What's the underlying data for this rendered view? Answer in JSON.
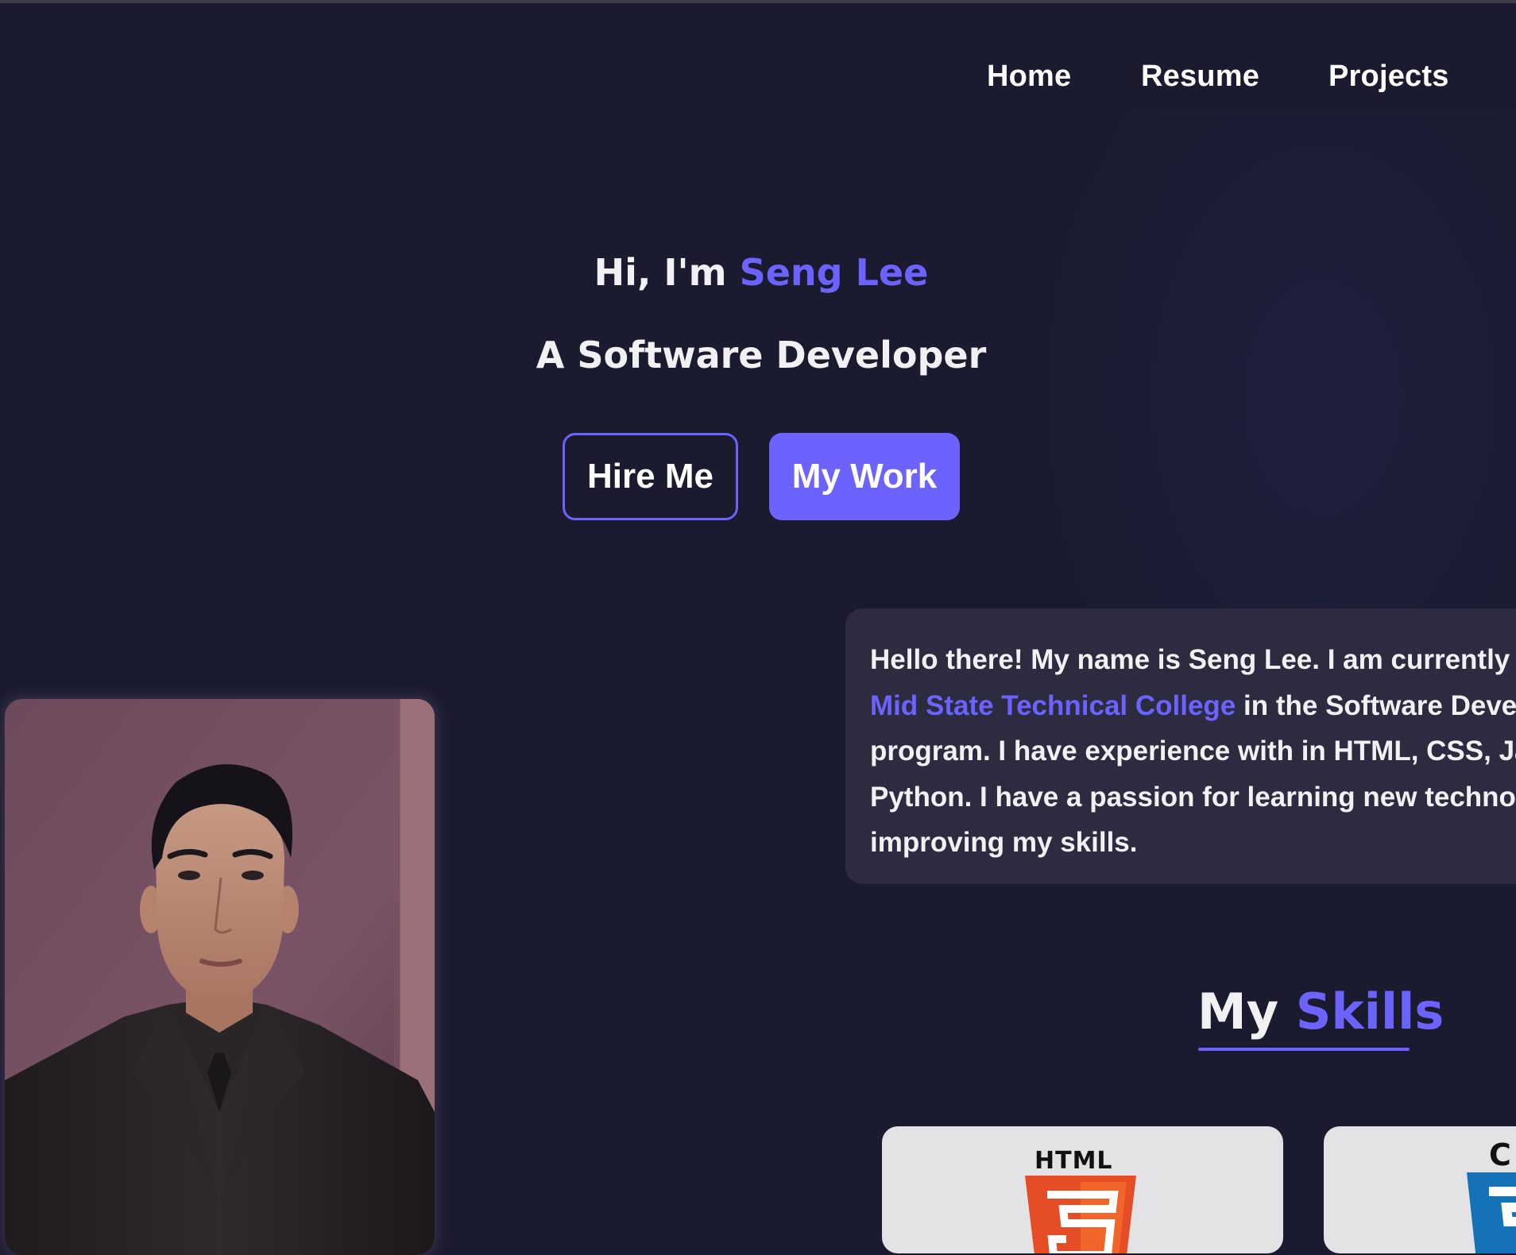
{
  "nav": {
    "home": "Home",
    "resume": "Resume",
    "projects": "Projects"
  },
  "hero": {
    "greeting_prefix": "Hi, I'm",
    "name": "Seng Lee",
    "role": "A Software Developer",
    "hire_button": "Hire Me",
    "work_button": "My Work"
  },
  "about": {
    "line1": "Hello there! My name is Seng Lee. I am currently",
    "college_link": "Mid State Technical College",
    "line2_rest": "in the Software Deve",
    "line3": "program. I have experience with in HTML, CSS, Ja",
    "line4": "Python. I have a passion for learning new techno",
    "line5": "improving my skills."
  },
  "skills": {
    "title_prefix": "My",
    "title_accent": "Skills",
    "items": [
      {
        "label": "HTML",
        "icon": "html5-icon"
      },
      {
        "label": "C",
        "icon": "css3-icon"
      }
    ]
  },
  "colors": {
    "background": "#1b1b30",
    "accent": "#6c63ff",
    "card": "#2c2b40",
    "skill_card": "#e3e3e5",
    "html_orange": "#e44d26",
    "css_blue": "#1572b6"
  }
}
